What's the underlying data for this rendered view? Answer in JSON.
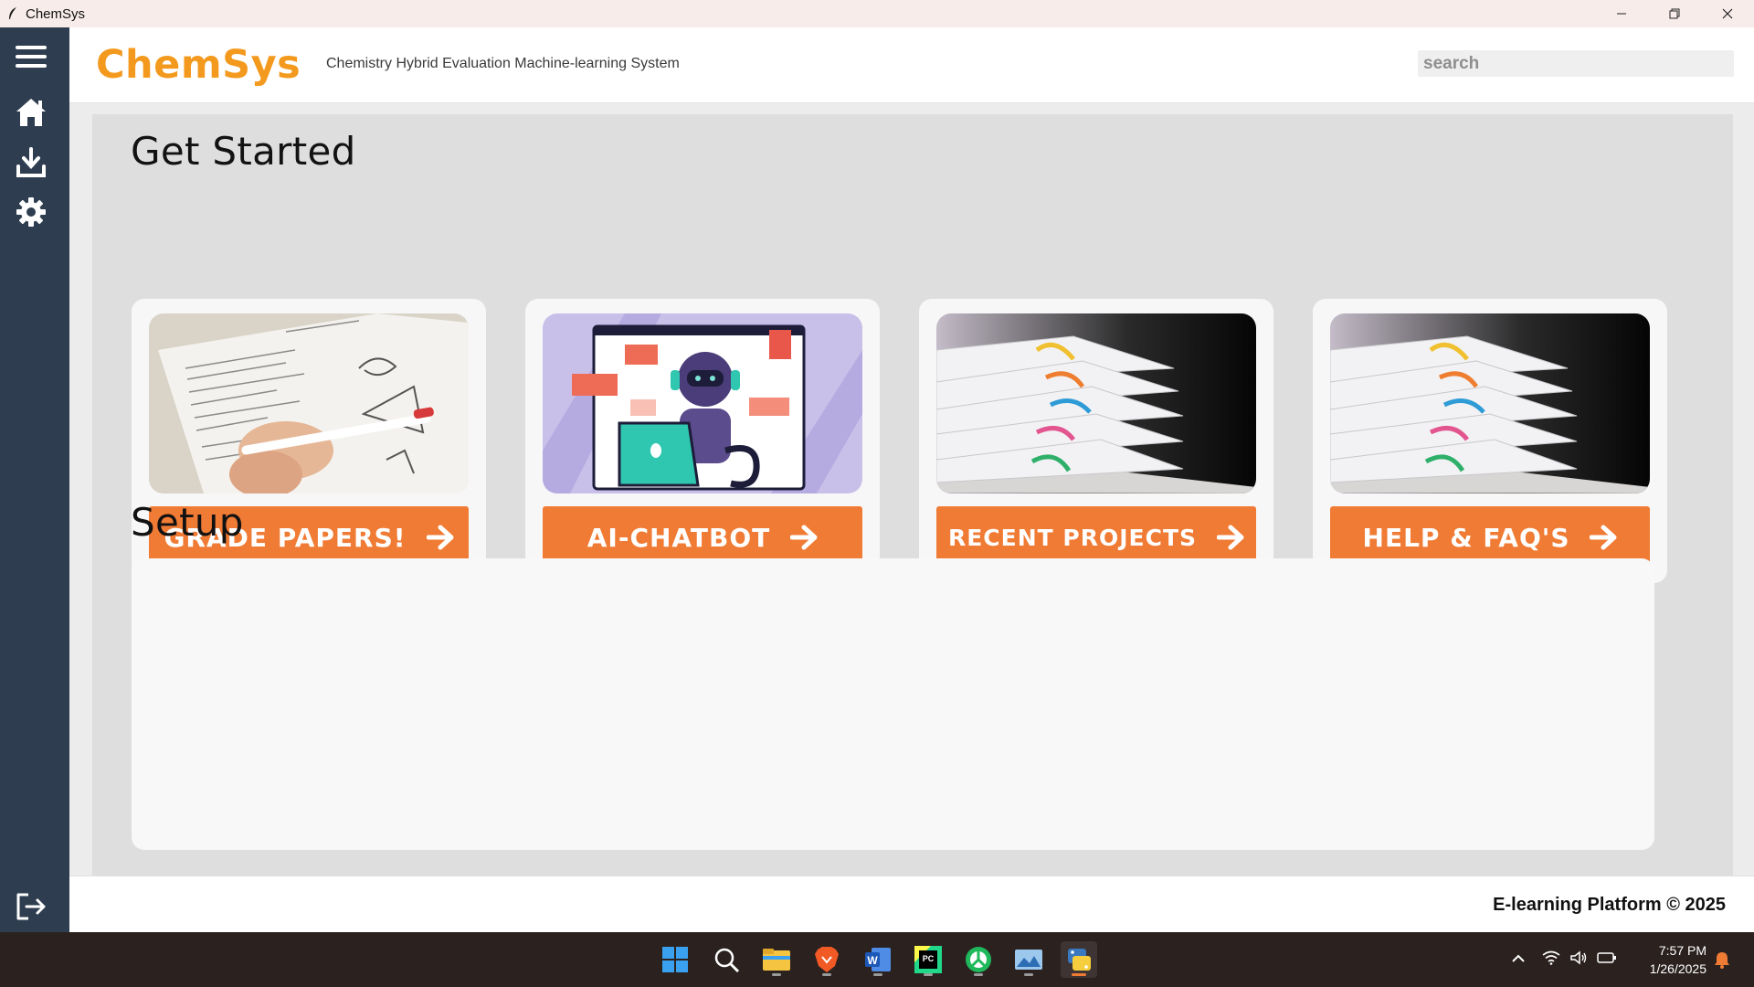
{
  "window": {
    "title": "ChemSys"
  },
  "header": {
    "brand": "ChemSys",
    "tagline": "Chemistry Hybrid Evaluation Machine-learning System",
    "search_placeholder": "search"
  },
  "sidebar": {
    "items": [
      {
        "name": "menu",
        "icon": "hamburger-menu-icon"
      },
      {
        "name": "home",
        "icon": "home-icon"
      },
      {
        "name": "download",
        "icon": "download-icon"
      },
      {
        "name": "settings",
        "icon": "gear-icon"
      },
      {
        "name": "logout",
        "icon": "logout-icon"
      }
    ]
  },
  "main": {
    "get_started_title": "Get Started",
    "setup_title": "Setup",
    "cards": [
      {
        "label": "GRADE PAPERS!",
        "image": "grading-paper-image"
      },
      {
        "label": "AI-CHATBOT",
        "image": "chatbot-robot-image"
      },
      {
        "label": "RECENT PROJECTS",
        "image": "stacked-papers-image"
      },
      {
        "label": "HELP & FAQ'S",
        "image": "stacked-papers-image"
      }
    ]
  },
  "footer": {
    "copyright": "E-learning Platform © 2025"
  },
  "taskbar": {
    "time": "7:57 PM",
    "date": "1/26/2025",
    "apps": [
      "start-icon",
      "search-icon",
      "file-explorer-icon",
      "brave-browser-icon",
      "word-icon",
      "pycharm-icon",
      "app-icon",
      "photos-icon",
      "python-icon"
    ]
  },
  "colors": {
    "accent_orange": "#f07b34",
    "brand_orange": "#f39a1e",
    "sidebar_navy": "#2e3d4f"
  }
}
